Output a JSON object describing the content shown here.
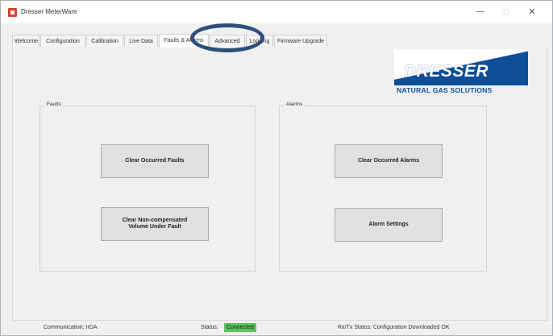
{
  "window": {
    "title": "Dresser MeterWare",
    "controls": {
      "minimize": "—",
      "maximize": "☐",
      "close": "✕"
    }
  },
  "tabs": [
    {
      "label": "Welcome",
      "active": false
    },
    {
      "label": "Configuration",
      "active": false
    },
    {
      "label": "Calibration",
      "active": false
    },
    {
      "label": "Live Data",
      "active": false
    },
    {
      "label": "Faults & Alarms",
      "active": true
    },
    {
      "label": "Advanced",
      "active": false
    },
    {
      "label": "Logging",
      "active": false
    },
    {
      "label": "Firmware Upgrade",
      "active": false
    }
  ],
  "logo": {
    "brand": "DRESSER",
    "tagline": "NATURAL GAS SOLUTIONS",
    "colors": {
      "band": "#0f4f9a",
      "text": "#0f4f9a"
    }
  },
  "faults": {
    "group_label": "Faults",
    "clear_occurred_label": "Clear Occurred Faults",
    "clear_noncomp_label": "Clear Non-compensated\nVolume Under Fault"
  },
  "alarms": {
    "group_label": "Alarms",
    "clear_occurred_label": "Clear Occurred Alarms",
    "settings_label": "Alarm Settings"
  },
  "status_bar": {
    "communication": "Communication: IrDA",
    "status_label": "Status:",
    "status_value": "Connected",
    "status_color": "#59c45a",
    "rxtx": "Rx/Tx Status: Configuration Downloaded OK"
  },
  "annotation": {
    "ring_color": "#2e4f79"
  }
}
